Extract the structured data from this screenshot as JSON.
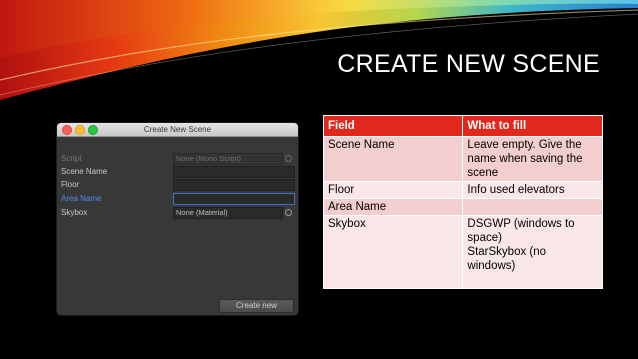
{
  "slide": {
    "title": "CREATE NEW SCENE"
  },
  "window": {
    "title": "Create New Scene",
    "fields": [
      {
        "label": "Script",
        "value": "None (Mono Script)",
        "state": "disabled"
      },
      {
        "label": "Scene Name",
        "value": "",
        "state": "normal"
      },
      {
        "label": "Floor",
        "value": "",
        "state": "normal"
      },
      {
        "label": "Area Name",
        "value": "",
        "state": "focused"
      },
      {
        "label": "Skybox",
        "value": "None (Material)",
        "state": "normal"
      }
    ],
    "create_button": "Create new"
  },
  "table": {
    "headers": [
      "Field",
      "What to fill"
    ],
    "rows": [
      {
        "field": "Scene Name",
        "fill": [
          "Leave empty. Give the",
          "name when saving the",
          "scene"
        ]
      },
      {
        "field": "Floor",
        "fill": [
          "Info used elevators"
        ]
      },
      {
        "field": "Area Name",
        "fill": [
          ""
        ]
      },
      {
        "field": "Skybox",
        "fill": [
          "DSGWP (windows to",
          "space)",
          "StarSkybox (no",
          "windows)"
        ]
      }
    ]
  },
  "colors": {
    "background": "#000000",
    "header_red": "#e0281c",
    "row_dark": "#f2cece",
    "row_light": "#f9e7e7",
    "focus_blue": "#4d8ef0"
  }
}
